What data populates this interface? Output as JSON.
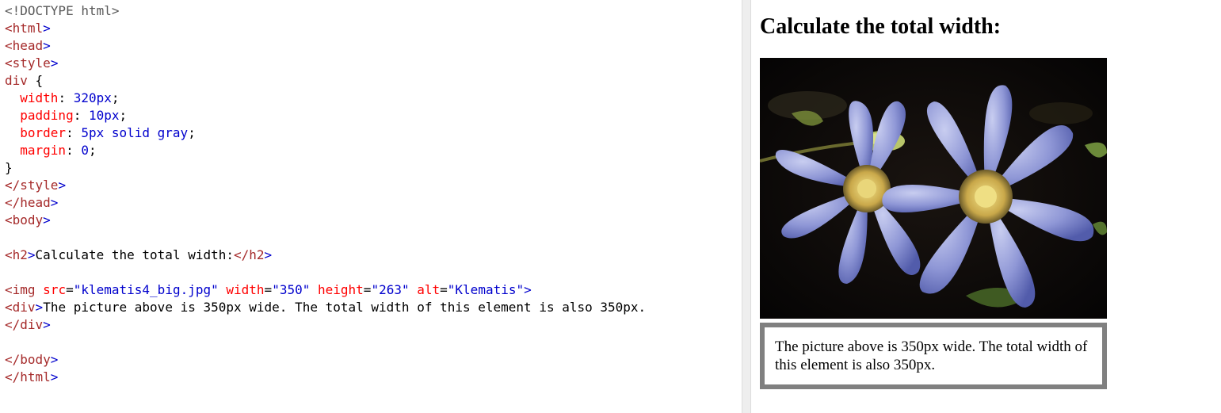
{
  "editor": {
    "lines": [
      [
        {
          "t": "<!DOCTYPE html>",
          "c": "doctype"
        }
      ],
      [
        {
          "t": "<",
          "c": "tag"
        },
        {
          "t": "html",
          "c": "tag"
        },
        {
          "t": ">",
          "c": "bracket"
        }
      ],
      [
        {
          "t": "<",
          "c": "tag"
        },
        {
          "t": "head",
          "c": "tag"
        },
        {
          "t": ">",
          "c": "bracket"
        }
      ],
      [
        {
          "t": "<",
          "c": "tag"
        },
        {
          "t": "style",
          "c": "tag"
        },
        {
          "t": ">",
          "c": "bracket"
        }
      ],
      [
        {
          "t": "div",
          "c": "selector"
        },
        {
          "t": " {",
          "c": "text"
        }
      ],
      [
        {
          "t": "  ",
          "c": "text"
        },
        {
          "t": "width",
          "c": "prop"
        },
        {
          "t": ": ",
          "c": "text"
        },
        {
          "t": "320px",
          "c": "value"
        },
        {
          "t": ";",
          "c": "text"
        }
      ],
      [
        {
          "t": "  ",
          "c": "text"
        },
        {
          "t": "padding",
          "c": "prop"
        },
        {
          "t": ": ",
          "c": "text"
        },
        {
          "t": "10px",
          "c": "value"
        },
        {
          "t": ";",
          "c": "text"
        }
      ],
      [
        {
          "t": "  ",
          "c": "text"
        },
        {
          "t": "border",
          "c": "prop"
        },
        {
          "t": ": ",
          "c": "text"
        },
        {
          "t": "5px solid gray",
          "c": "value"
        },
        {
          "t": ";",
          "c": "text"
        }
      ],
      [
        {
          "t": "  ",
          "c": "text"
        },
        {
          "t": "margin",
          "c": "prop"
        },
        {
          "t": ": ",
          "c": "text"
        },
        {
          "t": "0",
          "c": "value"
        },
        {
          "t": ";",
          "c": "text"
        }
      ],
      [
        {
          "t": "}",
          "c": "text"
        }
      ],
      [
        {
          "t": "</",
          "c": "tag"
        },
        {
          "t": "style",
          "c": "tag"
        },
        {
          "t": ">",
          "c": "bracket"
        }
      ],
      [
        {
          "t": "</",
          "c": "tag"
        },
        {
          "t": "head",
          "c": "tag"
        },
        {
          "t": ">",
          "c": "bracket"
        }
      ],
      [
        {
          "t": "<",
          "c": "tag"
        },
        {
          "t": "body",
          "c": "tag"
        },
        {
          "t": ">",
          "c": "bracket"
        }
      ],
      [],
      [
        {
          "t": "<",
          "c": "tag"
        },
        {
          "t": "h2",
          "c": "tag"
        },
        {
          "t": ">",
          "c": "bracket"
        },
        {
          "t": "Calculate the total width:",
          "c": "text"
        },
        {
          "t": "</",
          "c": "tag"
        },
        {
          "t": "h2",
          "c": "tag"
        },
        {
          "t": ">",
          "c": "bracket"
        }
      ],
      [],
      [
        {
          "t": "<",
          "c": "tag"
        },
        {
          "t": "img",
          "c": "tag"
        },
        {
          "t": " src",
          "c": "attr"
        },
        {
          "t": "=",
          "c": "text"
        },
        {
          "t": "\"klematis4_big.jpg\"",
          "c": "attrval"
        },
        {
          "t": " width",
          "c": "attr"
        },
        {
          "t": "=",
          "c": "text"
        },
        {
          "t": "\"350\"",
          "c": "attrval"
        },
        {
          "t": " height",
          "c": "attr"
        },
        {
          "t": "=",
          "c": "text"
        },
        {
          "t": "\"263\"",
          "c": "attrval"
        },
        {
          "t": " alt",
          "c": "attr"
        },
        {
          "t": "=",
          "c": "text"
        },
        {
          "t": "\"Klematis\"",
          "c": "attrval"
        },
        {
          "t": ">",
          "c": "bracket"
        }
      ],
      [
        {
          "t": "<",
          "c": "tag"
        },
        {
          "t": "div",
          "c": "tag"
        },
        {
          "t": ">",
          "c": "bracket"
        },
        {
          "t": "The picture above is 350px wide. The total width of this element is also 350px.",
          "c": "text"
        }
      ],
      [
        {
          "t": "</",
          "c": "tag"
        },
        {
          "t": "div",
          "c": "tag"
        },
        {
          "t": ">",
          "c": "bracket"
        }
      ],
      [],
      [
        {
          "t": "</",
          "c": "tag"
        },
        {
          "t": "body",
          "c": "tag"
        },
        {
          "t": ">",
          "c": "bracket"
        }
      ],
      [
        {
          "t": "</",
          "c": "tag"
        },
        {
          "t": "html",
          "c": "tag"
        },
        {
          "t": ">",
          "c": "bracket"
        }
      ]
    ]
  },
  "result": {
    "heading": "Calculate the total width:",
    "image_alt": "Klematis",
    "box_text": "The picture above is 350px wide. The total width of this element is also 350px."
  },
  "colors": {
    "tag": "#a52a2a",
    "attr": "#ff0000",
    "value": "#0000cd",
    "border_gray": "#808080"
  }
}
